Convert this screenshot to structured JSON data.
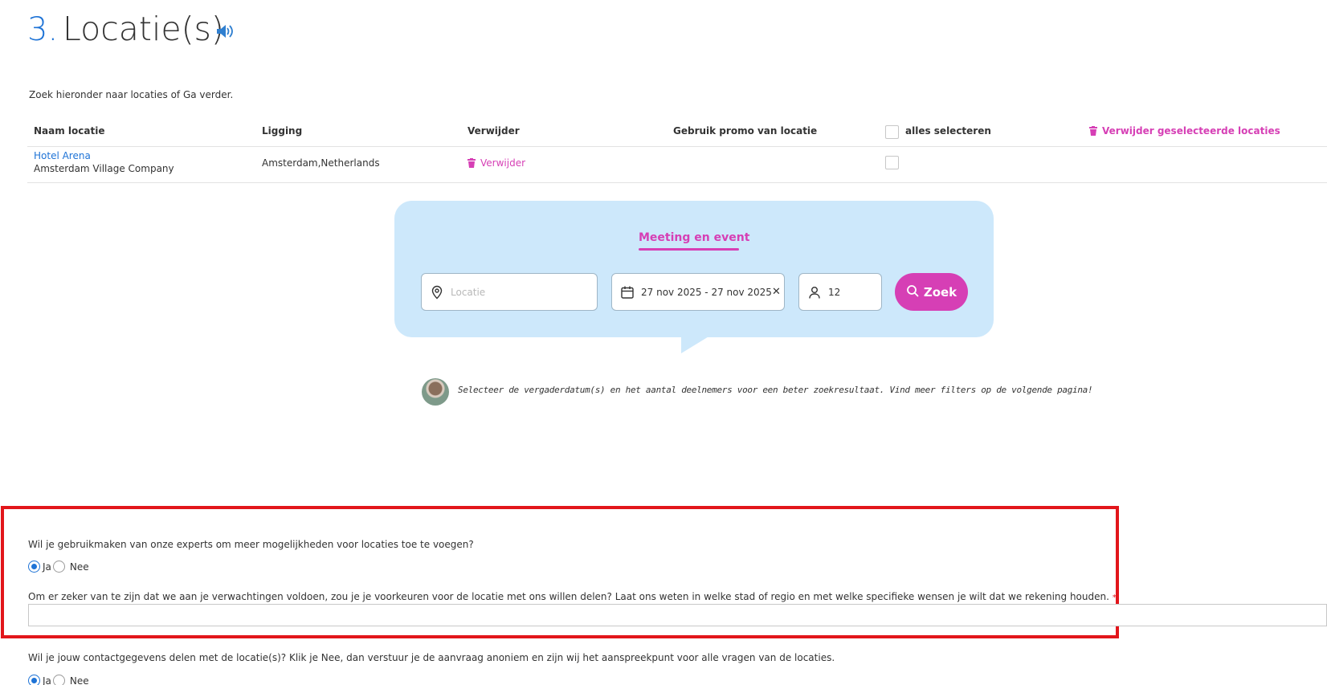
{
  "header": {
    "step_number": "3.",
    "title": "Locatie(s)"
  },
  "intro_text": "Zoek hieronder naar locaties of Ga verder.",
  "table": {
    "columns": {
      "name": "Naam locatie",
      "location": "Ligging",
      "delete": "Verwijder",
      "promo": "Gebruik promo van locatie",
      "select_all": "alles selecteren",
      "delete_selected": "Verwijder geselecteerde locaties"
    },
    "rows": [
      {
        "hotel_name": "Hotel Arena",
        "company": "Amsterdam Village Company",
        "location": "Amsterdam,Netherlands",
        "delete_label": "Verwijder"
      }
    ]
  },
  "search": {
    "tab_label": "Meeting en event",
    "location_placeholder": "Locatie",
    "date_range": "27 nov 2025 - 27 nov 2025",
    "clear_symbol": "✕",
    "participants": "12",
    "button_label": "Zoek",
    "tip": "Selecteer de vergaderdatum(s) en het aantal deelnemers voor een beter zoekresultaat. Vind meer filters op de volgende pagina!"
  },
  "questions": {
    "experts_question": "Wil je gebruikmaken van onze experts om meer mogelijkheden voor locaties toe te voegen?",
    "experts_options": {
      "yes": "Ja",
      "no": "Nee",
      "selected": "Ja"
    },
    "preferences_question": "Om er zeker van te zijn dat we aan je verwachtingen voldoen, zou je je voorkeuren voor de locatie met ons willen delen? Laat ons weten in welke stad of regio en met welke specifieke wensen je wilt dat we rekening houden.",
    "required_mark": "*",
    "preferences_value": "",
    "contact_question": "Wil je jouw contactgegevens delen met de locatie(s)? Klik je Nee, dan verstuur je de aanvraag anoniem en zijn wij het aanspreekpunt voor alle vragen van de locaties.",
    "contact_options": {
      "yes": "Ja",
      "no": "Nee",
      "selected": "Ja"
    }
  },
  "colors": {
    "accent_blue": "#1e73d6",
    "accent_pink": "#d63fb5",
    "card_bg": "#cde8fb",
    "highlight_red": "#e2161b"
  },
  "icons": [
    "speaker-icon",
    "trash-icon",
    "location-pin-icon",
    "calendar-icon",
    "close-icon",
    "person-icon",
    "search-icon"
  ]
}
